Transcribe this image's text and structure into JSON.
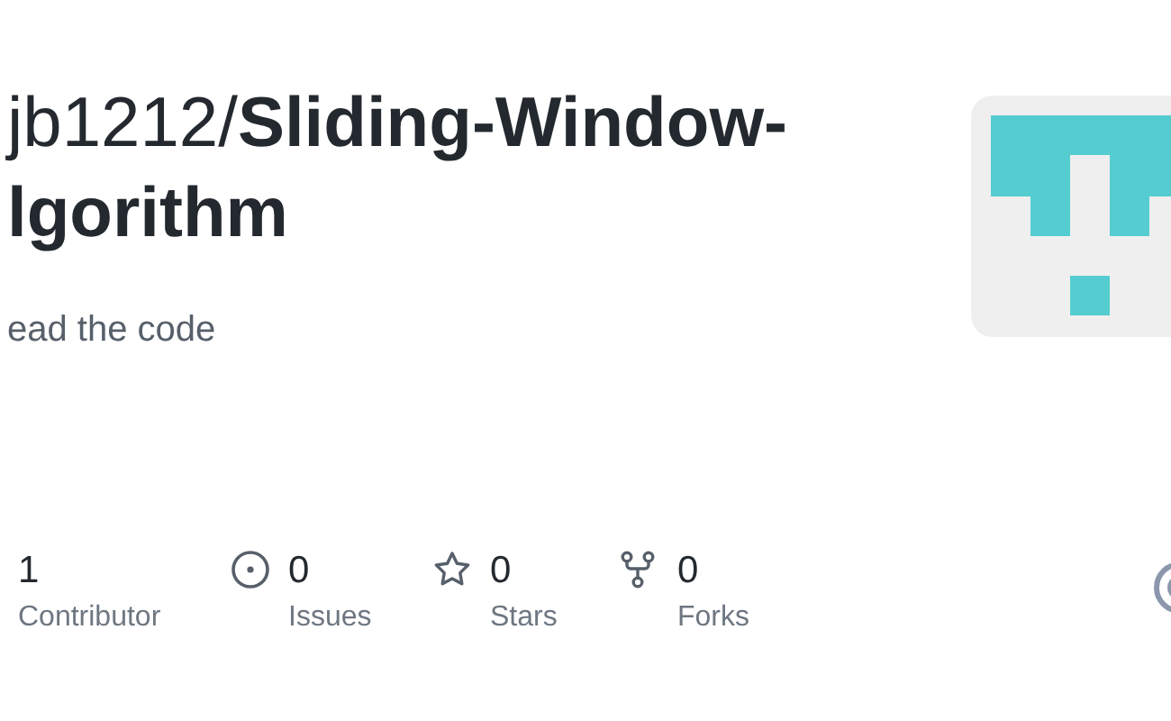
{
  "repo": {
    "owner": "jb1212/",
    "name": "Sliding-Window-",
    "name_rest": "lgorithm",
    "description": "ead the code"
  },
  "stats": [
    {
      "kind": "contributors",
      "value": "1",
      "label": "Contributor"
    },
    {
      "kind": "issues",
      "value": "0",
      "label": "Issues"
    },
    {
      "kind": "stars",
      "value": "0",
      "label": "Stars"
    },
    {
      "kind": "forks",
      "value": "0",
      "label": "Forks"
    }
  ]
}
